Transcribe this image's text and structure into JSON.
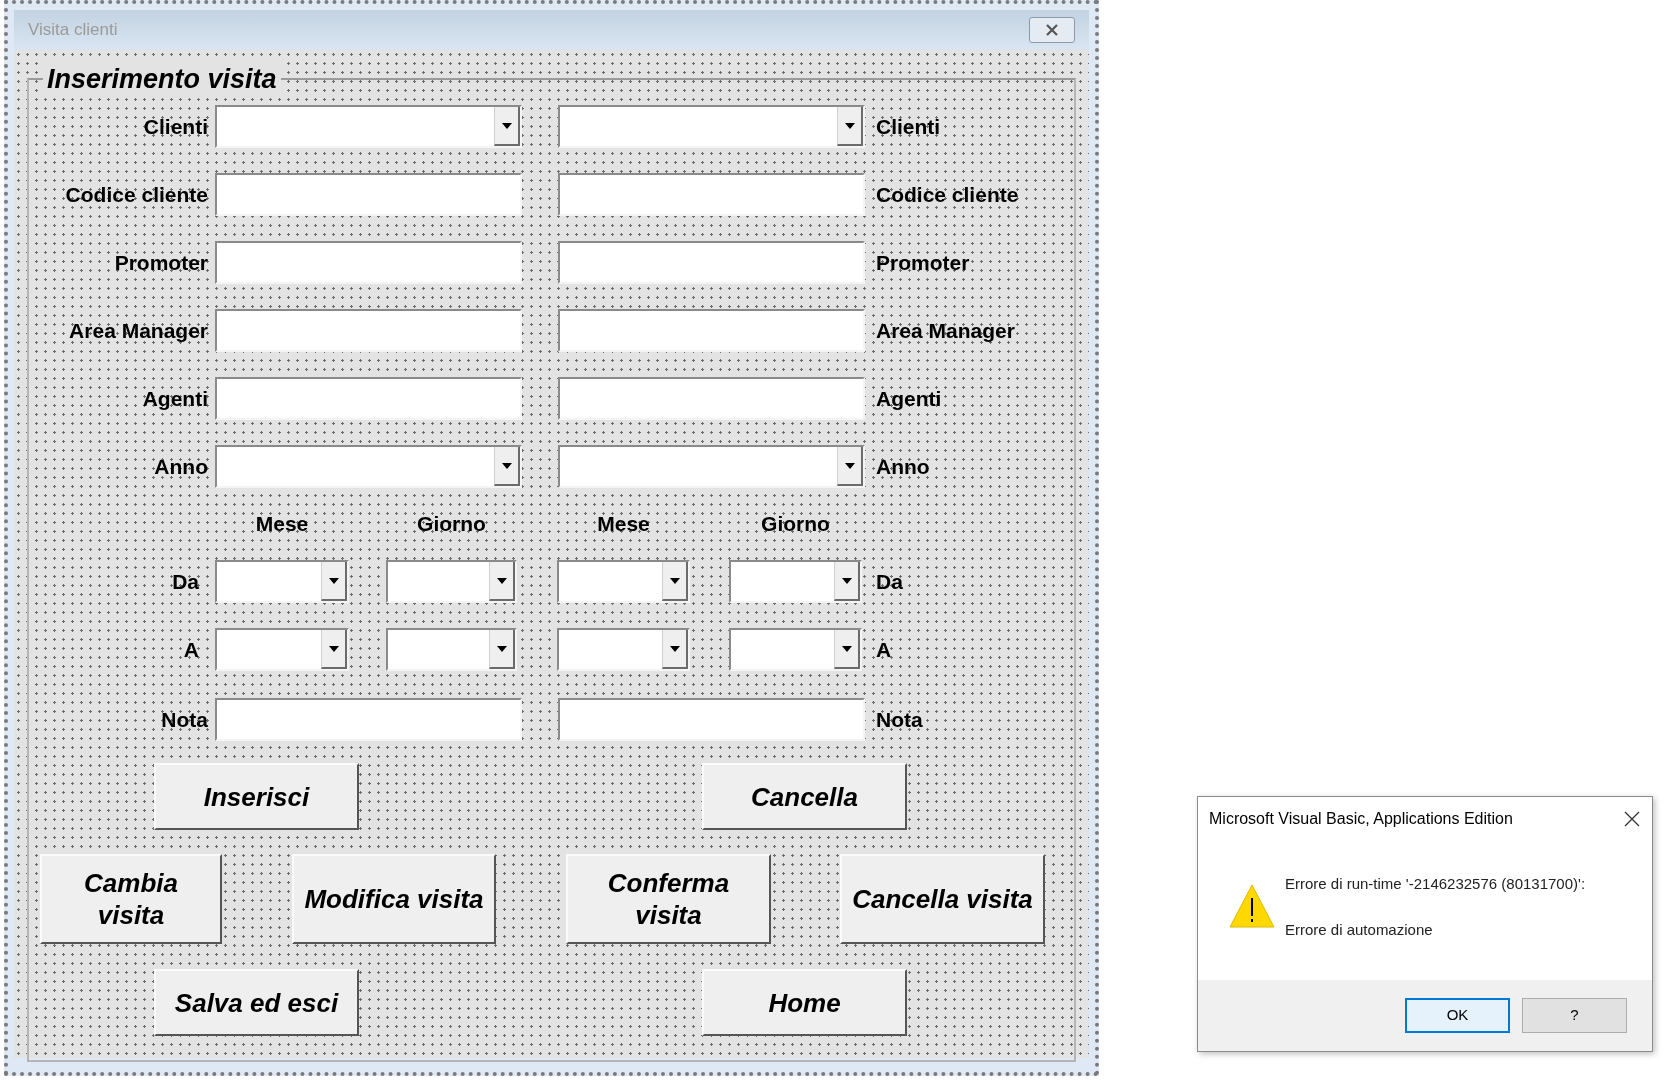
{
  "window": {
    "title": "Visita clienti"
  },
  "frame": {
    "legend": "Inserimento visita",
    "field_rows": [
      {
        "kind": "combo",
        "label_left": "Clienti",
        "label_right": "Clienti"
      },
      {
        "kind": "text",
        "label_left": "Codice cliente",
        "label_right": "Codice cliente"
      },
      {
        "kind": "text",
        "label_left": "Promoter",
        "label_right": "Promoter"
      },
      {
        "kind": "text",
        "label_left": "Area Manager",
        "label_right": "Area Manager"
      },
      {
        "kind": "text",
        "label_left": "Agenti",
        "label_right": "Agenti"
      },
      {
        "kind": "combo",
        "label_left": "Anno",
        "label_right": "Anno"
      }
    ],
    "date_headers": [
      "Mese",
      "Giorno",
      "Mese",
      "Giorno"
    ],
    "date_rows": [
      {
        "label_left": "Da",
        "label_right": "Da"
      },
      {
        "label_left": "A",
        "label_right": "A"
      }
    ],
    "note_row": {
      "kind": "text",
      "label_left": "Nota",
      "label_right": "Nota"
    },
    "button_rows": [
      [
        {
          "label": "Inserisci",
          "kind": "wide"
        },
        {
          "label": "Cancella",
          "kind": "wide"
        }
      ],
      [
        {
          "label": "Cambia visita",
          "kind": "stacked"
        },
        {
          "label": "Modifica visita",
          "kind": "wide"
        },
        {
          "label": "Conferma visita",
          "kind": "stacked"
        },
        {
          "label": "Cancella visita",
          "kind": "wide"
        }
      ],
      [
        {
          "label": "Salva ed esci",
          "kind": "wide"
        },
        {
          "label": "Home",
          "kind": "wide"
        }
      ]
    ]
  },
  "dialog": {
    "title": "Microsoft Visual Basic, Applications Edition",
    "message": "Errore di run-time '-2146232576 (80131700)':",
    "detail": "Errore di automazione",
    "buttons": [
      {
        "label": "OK",
        "selected": true
      },
      {
        "label": "?",
        "selected": false
      }
    ]
  }
}
